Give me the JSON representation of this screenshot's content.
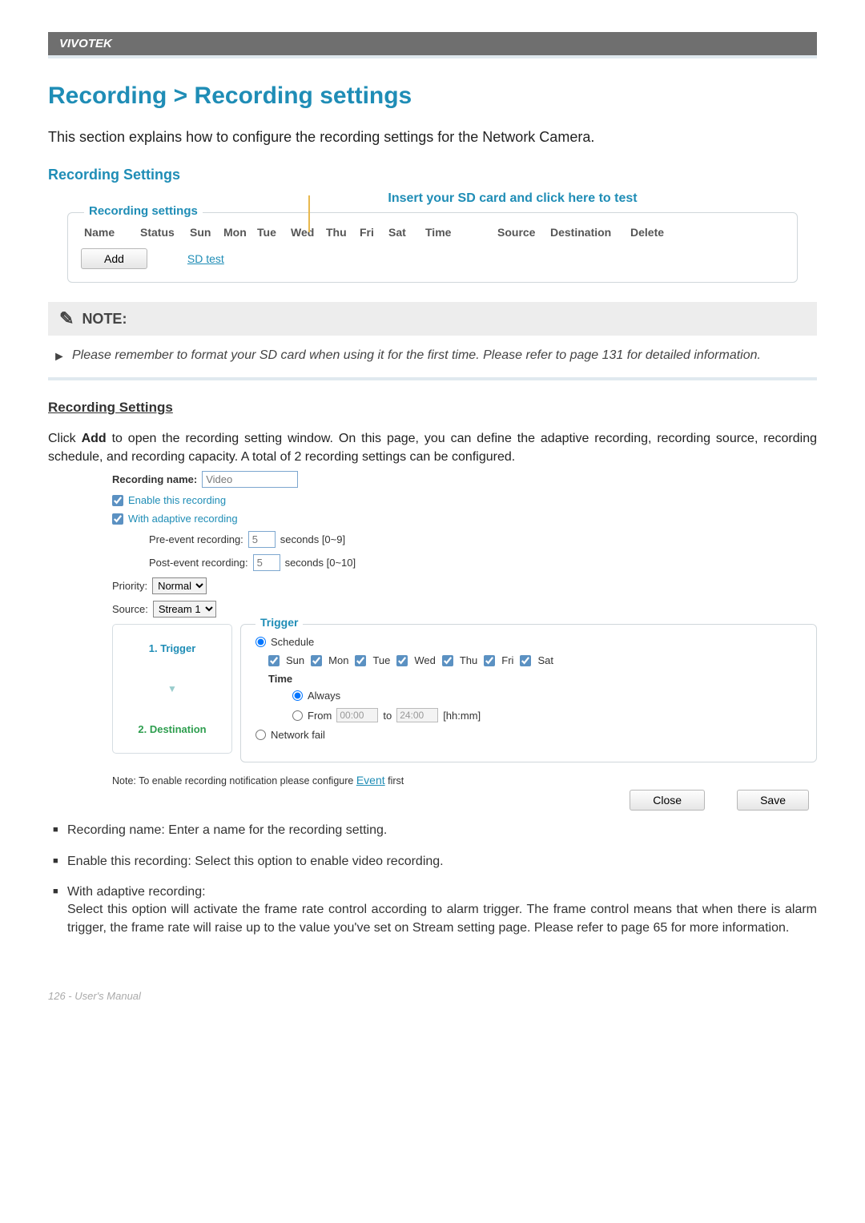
{
  "brand": "VIVOTEK",
  "page_title": "Recording > Recording settings",
  "intro": "This section explains how to configure the recording settings for the Network Camera.",
  "recording_settings_heading": "Recording Settings",
  "sd_insert_note": "Insert your SD card and click here to test",
  "panel1": {
    "legend": "Recording settings",
    "columns": [
      "Name",
      "Status",
      "Sun",
      "Mon",
      "Tue",
      "Wed",
      "Thu",
      "Fri",
      "Sat",
      "Time",
      "Source",
      "Destination",
      "Delete"
    ],
    "add_label": "Add",
    "sd_test_label": "SD test"
  },
  "note": {
    "title": "NOTE:",
    "text": "Please remember to format your SD card when using it for the first time. Please refer to page 131 for detailed information."
  },
  "section2": {
    "heading": "Recording Settings",
    "para_prefix": "Click ",
    "para_bold": "Add",
    "para_suffix": " to open the recording setting window. On this page, you can define the adaptive recording, recording source, recording schedule, and recording capacity. A total of 2 recording settings can be configured."
  },
  "form": {
    "name_label": "Recording name:",
    "name_value": "Video",
    "enable_label": "Enable this recording",
    "adaptive_label": "With adaptive recording",
    "pre_label": "Pre-event recording:",
    "pre_value": "5",
    "pre_unit": "seconds [0~9]",
    "post_label": "Post-event recording:",
    "post_value": "5",
    "post_unit": "seconds [0~10]",
    "priority_label": "Priority:",
    "priority_value": "Normal",
    "source_label": "Source:",
    "source_value": "Stream 1",
    "steps": {
      "s1": "1.  Trigger",
      "s2": "2.  Destination"
    },
    "trigger": {
      "legend": "Trigger",
      "schedule_label": "Schedule",
      "days": [
        "Sun",
        "Mon",
        "Tue",
        "Wed",
        "Thu",
        "Fri",
        "Sat"
      ],
      "time_label": "Time",
      "always_label": "Always",
      "from_label": "From",
      "from_value": "00:00",
      "to_label": "to",
      "to_value": "24:00",
      "hhmm": "[hh:mm]",
      "network_fail_label": "Network fail"
    },
    "footnote_prefix": "Note: To enable recording notification please configure ",
    "footnote_link": "Event",
    "footnote_suffix": " first",
    "close_label": "Close",
    "save_label": "Save"
  },
  "bullets": {
    "b1": "Recording name: Enter a name for the recording setting.",
    "b2": "Enable this recording: Select this option to enable video recording.",
    "b3_title": "With adaptive recording:",
    "b3_body": "Select this option will activate the frame rate control according to alarm trigger. The frame control means that when there is alarm trigger, the frame rate will raise up to the value you've set on Stream setting page. Please refer to page 65 for more information."
  },
  "footer": "126 - User's Manual"
}
